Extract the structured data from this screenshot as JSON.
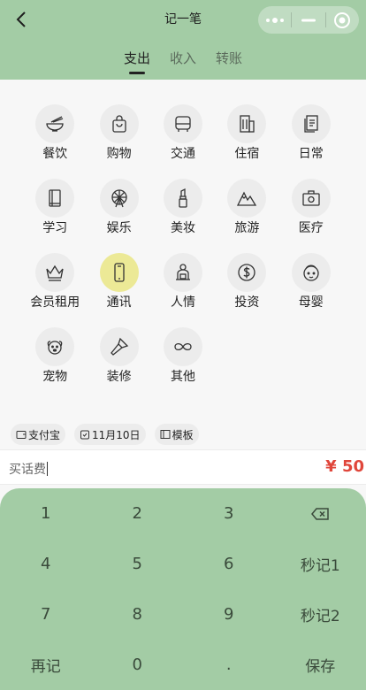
{
  "header": {
    "title": "记一笔",
    "back_icon": "chevron-left-icon",
    "capsule": [
      "more-dots-icon",
      "minimize-icon",
      "close-target-icon"
    ]
  },
  "tabs": [
    {
      "label": "支出",
      "active": true
    },
    {
      "label": "收入",
      "active": false
    },
    {
      "label": "转账",
      "active": false
    }
  ],
  "categories": [
    {
      "label": "餐饮",
      "icon": "bowl-icon"
    },
    {
      "label": "购物",
      "icon": "shopping-bag-icon"
    },
    {
      "label": "交通",
      "icon": "bus-icon"
    },
    {
      "label": "住宿",
      "icon": "building-icon"
    },
    {
      "label": "日常",
      "icon": "notes-icon"
    },
    {
      "label": "学习",
      "icon": "book-icon"
    },
    {
      "label": "娱乐",
      "icon": "ferris-wheel-icon"
    },
    {
      "label": "美妆",
      "icon": "lipstick-icon"
    },
    {
      "label": "旅游",
      "icon": "mountain-icon"
    },
    {
      "label": "医疗",
      "icon": "medical-kit-icon"
    },
    {
      "label": "会员租用",
      "icon": "crown-icon"
    },
    {
      "label": "通讯",
      "icon": "phone-icon",
      "selected": true
    },
    {
      "label": "人情",
      "icon": "person-gift-icon"
    },
    {
      "label": "投资",
      "icon": "dollar-coin-icon"
    },
    {
      "label": "母婴",
      "icon": "baby-face-icon"
    },
    {
      "label": "宠物",
      "icon": "dog-face-icon"
    },
    {
      "label": "装修",
      "icon": "paint-brush-icon"
    },
    {
      "label": "其他",
      "icon": "infinity-icon"
    }
  ],
  "chips": {
    "account": "支付宝",
    "date": "11月10日",
    "template": "模板"
  },
  "note": {
    "value": "买话费"
  },
  "amount": {
    "symbol": "¥",
    "value": "50"
  },
  "keypad": [
    [
      "1",
      "2",
      "3",
      "backspace-icon"
    ],
    [
      "4",
      "5",
      "6",
      "秒记1"
    ],
    [
      "7",
      "8",
      "9",
      "秒记2"
    ],
    [
      "再记",
      "0",
      ".",
      "保存"
    ]
  ],
  "colors": {
    "header_bg": "#a3cca5",
    "selected_icon_bg": "#ece996",
    "amount": "#e0463b"
  }
}
